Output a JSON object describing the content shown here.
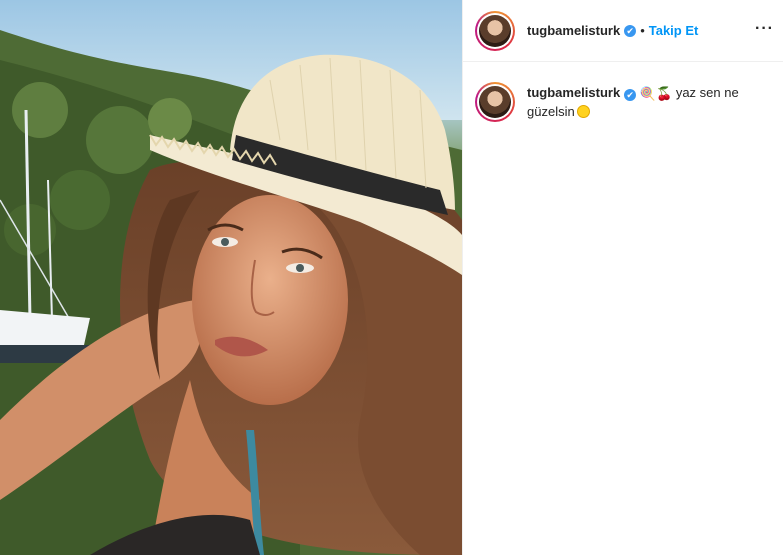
{
  "post": {
    "username": "tugbamelisturk",
    "verified": "✔",
    "separator": "•",
    "follow_label": "Takip Et",
    "more_label": "···"
  },
  "caption": {
    "username": "tugbamelisturk",
    "verified": "✔",
    "emoji_1": "🍭",
    "emoji_2": "🍒",
    "text_1": "yaz sen ne",
    "text_2": "güzelsin"
  },
  "colors": {
    "link": "#0095f6",
    "verified": "#3897f0",
    "text": "#262626"
  }
}
